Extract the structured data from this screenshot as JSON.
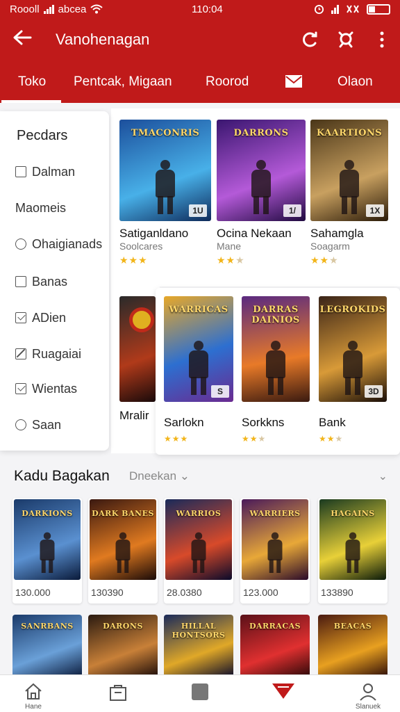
{
  "status_bar": {
    "carrier": "Roooll",
    "carrier_extra": "abcea",
    "time": "110:04",
    "icons": [
      "signal-icon",
      "wifi-icon",
      "alarm-icon",
      "battery-icon"
    ]
  },
  "app_bar": {
    "title": "Vanohenagan",
    "actions": [
      "refresh-icon",
      "search-icon",
      "more-icon"
    ]
  },
  "tabs": [
    {
      "label": "Toko",
      "active": true
    },
    {
      "label": "Pentcak, Migaan",
      "active": false
    },
    {
      "label": "Roorod",
      "active": false
    },
    {
      "label": "",
      "icon": "mail-icon",
      "active": false
    },
    {
      "label": "Olaon",
      "active": false
    }
  ],
  "side_menu": {
    "title": "Pecdars",
    "items": [
      {
        "label": "Dalman",
        "icon": "square"
      },
      {
        "label": "Maomeis",
        "icon": "none"
      },
      {
        "label": "Ohaigianads",
        "icon": "circle"
      },
      {
        "label": "Banas",
        "icon": "square"
      },
      {
        "label": "ADien",
        "icon": "check"
      },
      {
        "label": "Ruagaiai",
        "icon": "edit"
      },
      {
        "label": "Wientas",
        "icon": "check"
      },
      {
        "label": "Saan",
        "icon": "circle"
      }
    ]
  },
  "featured_row1": [
    {
      "art_title": "TMACONRIS",
      "badge": "1U",
      "name": "Satiganldano",
      "sub": "Soolcares",
      "rating": 3,
      "colors": [
        "#1c4f9c",
        "#48b0e8"
      ]
    },
    {
      "art_title": "DARRONS",
      "badge": "1/",
      "name": "Ocina Nekaan",
      "sub": "Mane",
      "rating": 2.5,
      "colors": [
        "#3a1670",
        "#b45ad8"
      ]
    },
    {
      "art_title": "KAARTIONS",
      "badge": "1X",
      "name": "Sahamgla",
      "sub": "Soagarm",
      "rating": 2.5,
      "colors": [
        "#4a3618",
        "#c8a060"
      ]
    }
  ],
  "featured_row2": [
    {
      "art_title": "",
      "badge": "",
      "name": "Mralir",
      "rating": 0,
      "colors": [
        "#2a2a2a",
        "#b03a1a"
      ]
    },
    {
      "art_title": "WARRICAS",
      "badge": "S",
      "name": "Sarlokn",
      "rating": 3,
      "colors": [
        "#e8a828",
        "#2d6fd0"
      ]
    },
    {
      "art_title": "DARRAS DAINIOS",
      "badge": "",
      "name": "Sorkkns",
      "rating": 2.5,
      "colors": [
        "#5a2a80",
        "#e87a28"
      ]
    },
    {
      "art_title": "LEGROKIDS",
      "badge": "3D",
      "name": "Bank",
      "rating": 2.5,
      "colors": [
        "#3a2418",
        "#d89a38"
      ]
    }
  ],
  "section": {
    "title": "Kadu Bagakan",
    "filter_label": "Dneekan"
  },
  "grid_row1": [
    {
      "art_title": "DARKIONS",
      "price": "130.000",
      "colors": [
        "#1a3a6a",
        "#5a90d0"
      ]
    },
    {
      "art_title": "DARK BANES",
      "price": "130390",
      "colors": [
        "#3a1810",
        "#e07a20"
      ]
    },
    {
      "art_title": "WARRIOS",
      "price": "28.0380",
      "colors": [
        "#1a2a5a",
        "#d84a2a"
      ]
    },
    {
      "art_title": "WARRIERS",
      "price": "123.000",
      "colors": [
        "#4a1a5a",
        "#e8a838"
      ]
    },
    {
      "art_title": "HAGAINS",
      "price": "133890",
      "colors": [
        "#1a3a20",
        "#e8d038"
      ]
    }
  ],
  "grid_row2": [
    {
      "art_title": "SANRBANS",
      "colors": [
        "#1a3a6a",
        "#6aa0d8"
      ]
    },
    {
      "art_title": "DARONS",
      "colors": [
        "#2a1a10",
        "#c88038"
      ]
    },
    {
      "art_title": "HILLAL HONTSORS",
      "colors": [
        "#1a2a5a",
        "#e0a828"
      ]
    },
    {
      "art_title": "DARRACAS",
      "colors": [
        "#5a1018",
        "#e03030"
      ]
    },
    {
      "art_title": "BEACAS",
      "colors": [
        "#4a1a10",
        "#e8a020"
      ]
    }
  ],
  "bottom_nav": [
    {
      "label": "Hane",
      "icon": "home-icon"
    },
    {
      "label": "",
      "icon": "bag-icon"
    },
    {
      "label": "",
      "icon": "square-icon"
    },
    {
      "label": "",
      "icon": "tag-icon"
    },
    {
      "label": "Slanuek",
      "icon": "profile-icon"
    }
  ],
  "colors": {
    "brand": "#c01a1a",
    "star": "#f2b51a"
  }
}
